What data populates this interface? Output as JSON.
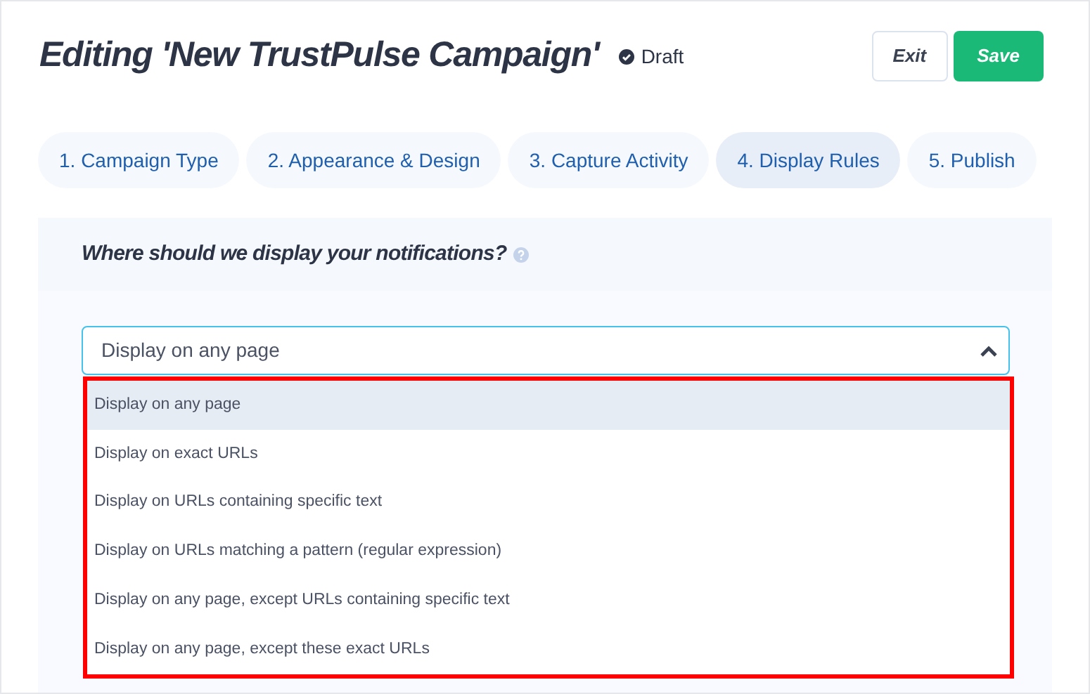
{
  "header": {
    "title": "Editing 'New TrustPulse Campaign'",
    "status": "Draft",
    "buttons": [
      {
        "kind": "secondary",
        "label": "Exit"
      },
      {
        "kind": "primary",
        "label": "Save"
      }
    ]
  },
  "tabs": [
    {
      "label": "1. Campaign Type",
      "selected": false
    },
    {
      "label": "2. Appearance & Design",
      "selected": false
    },
    {
      "label": "3. Capture Activity",
      "selected": false
    },
    {
      "label": "4. Display Rules",
      "selected": true
    },
    {
      "label": "5. Publish",
      "selected": false
    }
  ],
  "section": {
    "question": "Where should we display your notifications?",
    "select": {
      "value": "Display on any page",
      "expanded": true
    },
    "options": [
      {
        "label": "Display on any page",
        "selected": true
      },
      {
        "label": "Display on exact URLs",
        "selected": false
      },
      {
        "label": "Display on URLs containing specific text",
        "selected": false
      },
      {
        "label": "Display on URLs matching a pattern (regular expression)",
        "selected": false
      },
      {
        "label": "Display on any page, except URLs containing specific text",
        "selected": false
      },
      {
        "label": "Display on any page, except these exact URLs",
        "selected": false
      }
    ]
  }
}
